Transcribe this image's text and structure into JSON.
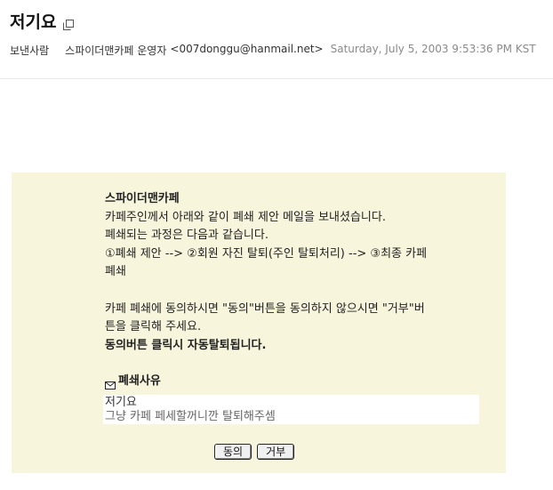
{
  "header": {
    "subject": "저기요",
    "popout_icon": "popout-window-icon",
    "sender_label": "보낸사람",
    "sender_name": "스파이더맨카페 운영자",
    "sender_email": "<007donggu@hanmail.net>",
    "date": "Saturday, July 5, 2003 9:53:36 PM KST"
  },
  "body": {
    "cafe_name": "스파이더맨카페",
    "line1": "카페주인께서 아래와 같이 폐쇄 제안 메일을 보내셨습니다.",
    "line2": "폐쇄되는 과정은 다음과 같습니다.",
    "line3": "①폐쇄 제안 --> ②회원 자진 탈퇴(주인 탈퇴처리) --> ③최종 카페",
    "line3b": "폐쇄",
    "line4": "카페 폐쇄에 동의하시면 \"동의\"버튼을 동의하지 않으시면 \"거부\"버",
    "line4b": "튼을 클릭해 주세요.",
    "line5": "동의버튼 클릭시 자동탈퇴됩니다.",
    "reason_icon": "envelope-icon",
    "reason_title": "폐쇄사유",
    "reason_subject": "저기요",
    "reason_text": "그냥 카페 페세할꺼니깐 탈퇴해주셈"
  },
  "buttons": {
    "agree": "동의",
    "reject": "거부"
  }
}
